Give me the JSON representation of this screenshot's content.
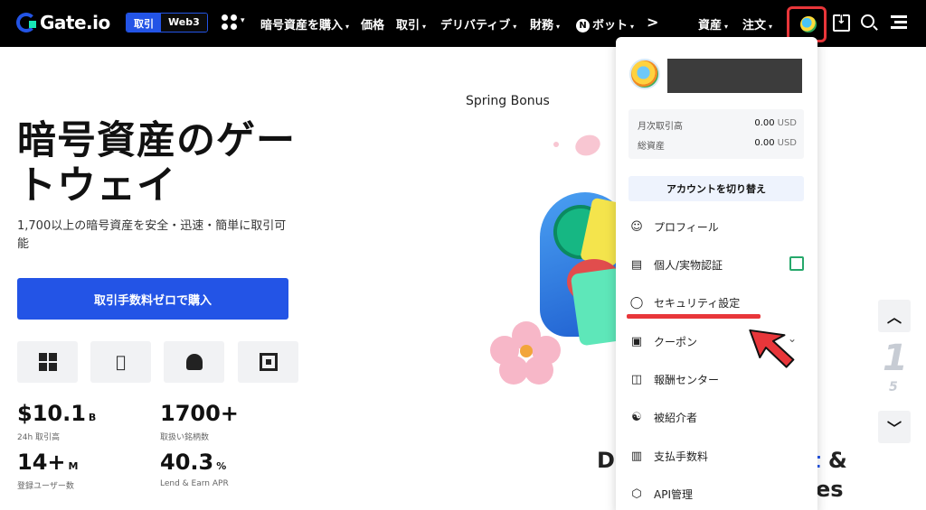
{
  "nav": {
    "logo": "Gate.io",
    "mode_primary": "取引",
    "mode_secondary": "Web3",
    "items": [
      {
        "label": "暗号資産を購入"
      },
      {
        "label": "価格"
      },
      {
        "label": "取引"
      },
      {
        "label": "デリバティブ"
      },
      {
        "label": "財務"
      },
      {
        "label": "ボット"
      }
    ],
    "more_glyph": ">",
    "right_items": [
      {
        "label": "資産"
      },
      {
        "label": "注文"
      }
    ]
  },
  "hero": {
    "title": "暗号資産のゲートウェイ",
    "subtitle": "1,700以上の暗号資産を安全・迅速・簡単に取引可能",
    "cta": "取引手数料ゼロで購入"
  },
  "stats": [
    {
      "value": "$10.1",
      "unit": "B",
      "caption": "24h 取引高"
    },
    {
      "value": "1700+",
      "unit": "",
      "caption": "取扱い銘柄数"
    },
    {
      "value": "14+",
      "unit": "M",
      "caption": "登録ユーザー数"
    },
    {
      "value": "40.3",
      "unit": "%",
      "caption": "Lend & Earn APR"
    }
  ],
  "promo": {
    "label": "Spring Bonus",
    "bottom_left": "Di",
    "bottom_right_accent": "t",
    "bottom_right_amp": " &",
    "bottom_right_2": "es"
  },
  "carousel": {
    "up_glyph": "︿",
    "down_glyph": "﹀",
    "slide_num": "1",
    "slide_small": "5"
  },
  "account_menu": {
    "stats": [
      {
        "label": "月次取引高",
        "value": "0.00",
        "unit": "USD"
      },
      {
        "label": "総資産",
        "value": "0.00",
        "unit": "USD"
      }
    ],
    "switch_account": "アカウントを切り替え",
    "items": [
      {
        "label": "プロフィール",
        "icon": "profile-icon"
      },
      {
        "label": "個人/実物認証",
        "icon": "id-card-icon"
      },
      {
        "label": "セキュリティ設定",
        "icon": "shield-icon"
      },
      {
        "label": "クーポン",
        "icon": "coupon-icon"
      },
      {
        "label": "報酬センター",
        "icon": "gift-icon"
      },
      {
        "label": "被紹介者",
        "icon": "coins-icon"
      },
      {
        "label": "支払手数料",
        "icon": "fee-icon"
      },
      {
        "label": "API管理",
        "icon": "api-icon"
      }
    ]
  },
  "colors": {
    "accent": "#2354e6",
    "highlight": "#e8363a",
    "nav_bg": "#000000"
  }
}
